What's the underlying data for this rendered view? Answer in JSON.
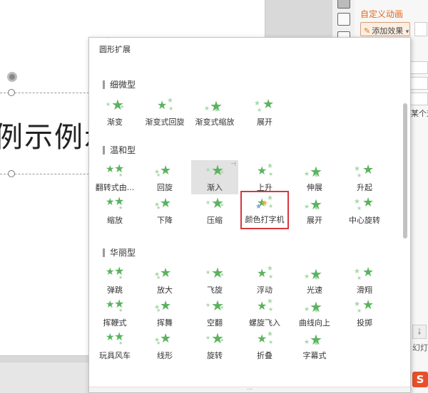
{
  "slide": {
    "text": "例示例示"
  },
  "panel": {
    "title": "自定义动画",
    "add_effect": "添加效果",
    "note": "某个对象，然后单击",
    "slide_label": "幻灯"
  },
  "icons": {
    "star": "★",
    "pen": "✎",
    "dropdown": "▾",
    "arrow_down": "🠗"
  },
  "colors": {
    "accent": "#e06a1b",
    "star_green": "#5ab35e",
    "selected_border": "#d9363e"
  },
  "dropdown": {
    "top_effect": "圆形扩展",
    "sections": [
      {
        "title": "细微型",
        "items": [
          "渐变",
          "渐变式回旋",
          "渐变式缩放",
          "展开"
        ]
      },
      {
        "title": "温和型",
        "items": [
          "翻转式由...",
          "回旋",
          "渐入",
          "上升",
          "伸展",
          "升起",
          "缩放",
          "下降",
          "压缩",
          "颜色打字机",
          "展开",
          "中心旋转"
        ]
      },
      {
        "title": "华丽型",
        "items": [
          "弹跳",
          "放大",
          "飞旋",
          "浮动",
          "光速",
          "滑翔",
          "挥鞭式",
          "挥舞",
          "空翻",
          "螺旋飞入",
          "曲线向上",
          "投掷",
          "玩具风车",
          "线形",
          "旋转",
          "折叠",
          "字幕式"
        ]
      }
    ],
    "hovered_item": "渐入",
    "selected_item": "颜色打字机"
  }
}
